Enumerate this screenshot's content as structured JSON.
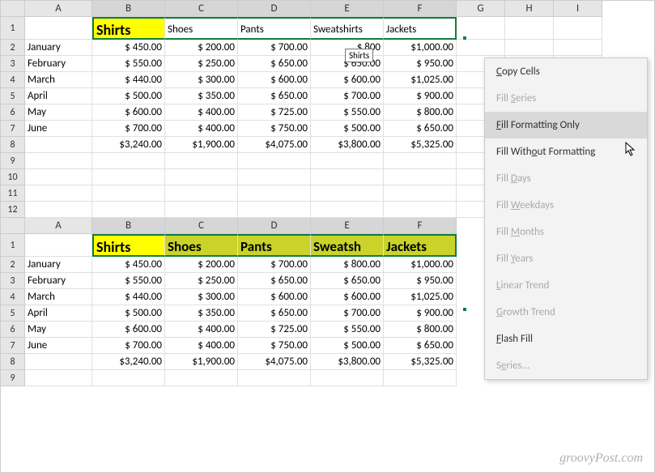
{
  "columns": [
    "A",
    "B",
    "C",
    "D",
    "E",
    "F",
    "G",
    "H",
    "I"
  ],
  "top": {
    "sel_cols": [
      "B",
      "C",
      "D",
      "E",
      "F"
    ],
    "rows": [
      {
        "n": "1",
        "tall": true,
        "cells": [
          "",
          "Shirts",
          "Shoes",
          "Pants",
          "Sweatshirts",
          "Jackets",
          "",
          "",
          ""
        ],
        "styles": [
          "",
          "hdr-yellow",
          "",
          "",
          "",
          "",
          "",
          "",
          ""
        ],
        "selRow": true
      },
      {
        "n": "2",
        "cells": [
          "January",
          "$   450.00",
          "$   200.00",
          "$   700.00",
          "$   800",
          "$1,000.00",
          "",
          "",
          ""
        ]
      },
      {
        "n": "3",
        "cells": [
          "February",
          "$   550.00",
          "$   250.00",
          "$   650.00",
          "$   650.00",
          "$   950.00",
          "",
          "",
          ""
        ]
      },
      {
        "n": "4",
        "cells": [
          "March",
          "$   440.00",
          "$   300.00",
          "$   600.00",
          "$   600.00",
          "$1,025.00",
          "",
          "",
          ""
        ]
      },
      {
        "n": "5",
        "cells": [
          "April",
          "$   500.00",
          "$   350.00",
          "$   650.00",
          "$   700.00",
          "$   900.00",
          "",
          "",
          ""
        ]
      },
      {
        "n": "6",
        "cells": [
          "May",
          "$   600.00",
          "$   400.00",
          "$   725.00",
          "$   550.00",
          "$   800.00",
          "",
          "",
          ""
        ]
      },
      {
        "n": "7",
        "cells": [
          "June",
          "$   700.00",
          "$   400.00",
          "$   750.00",
          "$   500.00",
          "$   650.00",
          "",
          "",
          ""
        ]
      },
      {
        "n": "8",
        "cells": [
          "",
          "$3,240.00",
          "$1,900.00",
          "$4,075.00",
          "$3,800.00",
          "$5,325.00",
          "",
          "",
          ""
        ]
      },
      {
        "n": "9",
        "cells": [
          "",
          "",
          "",
          "",
          "",
          "",
          "",
          "",
          ""
        ]
      },
      {
        "n": "10",
        "cells": [
          "",
          "",
          "",
          "",
          "",
          "",
          "",
          "",
          ""
        ]
      },
      {
        "n": "11",
        "cells": [
          "",
          "",
          "",
          "",
          "",
          "",
          "",
          "",
          ""
        ]
      },
      {
        "n": "12",
        "cells": [
          "",
          "",
          "",
          "",
          "",
          "",
          "",
          "",
          ""
        ]
      }
    ]
  },
  "bottom": {
    "columns": [
      "A",
      "B",
      "C",
      "D",
      "E",
      "F"
    ],
    "sel_cols": [
      "B",
      "C",
      "D",
      "E",
      "F"
    ],
    "rows": [
      {
        "n": "1",
        "tall": true,
        "cells": [
          "",
          "Shirts",
          "Shoes",
          "Pants",
          "Sweatsh",
          "Jackets"
        ],
        "styles": [
          "",
          "hdr-yellow",
          "hdr-olive",
          "hdr-olive",
          "hdr-olive",
          "hdr-olive"
        ],
        "selRow": true
      },
      {
        "n": "2",
        "cells": [
          "January",
          "$   450.00",
          "$   200.00",
          "$   700.00",
          "$   800.00",
          "$1,000.00"
        ]
      },
      {
        "n": "3",
        "cells": [
          "February",
          "$   550.00",
          "$   250.00",
          "$   650.00",
          "$   650.00",
          "$   950.00"
        ]
      },
      {
        "n": "4",
        "cells": [
          "March",
          "$   440.00",
          "$   300.00",
          "$   600.00",
          "$   600.00",
          "$1,025.00"
        ]
      },
      {
        "n": "5",
        "cells": [
          "April",
          "$   500.00",
          "$   350.00",
          "$   650.00",
          "$   700.00",
          "$   900.00"
        ]
      },
      {
        "n": "6",
        "cells": [
          "May",
          "$   600.00",
          "$   400.00",
          "$   725.00",
          "$   550.00",
          "$   800.00"
        ]
      },
      {
        "n": "7",
        "cells": [
          "June",
          "$   700.00",
          "$   400.00",
          "$   750.00",
          "$   500.00",
          "$   650.00"
        ]
      },
      {
        "n": "8",
        "cells": [
          "",
          "$3,240.00",
          "$1,900.00",
          "$4,075.00",
          "$3,800.00",
          "$5,325.00"
        ]
      },
      {
        "n": "9",
        "cells": [
          "",
          "",
          "",
          "",
          "",
          ""
        ]
      }
    ]
  },
  "tooltip": "Shirts",
  "ctx": {
    "items": [
      {
        "html": "<span class='ul'>C</span>opy Cells",
        "enabled": true
      },
      {
        "html": "Fill <span class='ul'>S</span>eries",
        "enabled": false
      },
      {
        "html": "<span class='ul'>F</span>ill Formatting Only",
        "enabled": true,
        "hover": true
      },
      {
        "html": "Fill With<span class='ul'>o</span>ut Formatting",
        "enabled": true
      },
      {
        "html": "Fill <span class='ul'>D</span>ays",
        "enabled": false
      },
      {
        "html": "Fill <span class='ul'>W</span>eekdays",
        "enabled": false
      },
      {
        "html": "Fill <span class='ul'>M</span>onths",
        "enabled": false
      },
      {
        "html": "Fill <span class='ul'>Y</span>ears",
        "enabled": false
      },
      {
        "html": "<span class='ul'>L</span>inear Trend",
        "enabled": false
      },
      {
        "html": "<span class='ul'>G</span>rowth Trend",
        "enabled": false
      },
      {
        "html": "<span class='ul'>F</span>lash Fill",
        "enabled": true
      },
      {
        "html": "S<span class='ul'>e</span>ries...",
        "enabled": false
      }
    ]
  },
  "watermark": "groovyPost.com"
}
